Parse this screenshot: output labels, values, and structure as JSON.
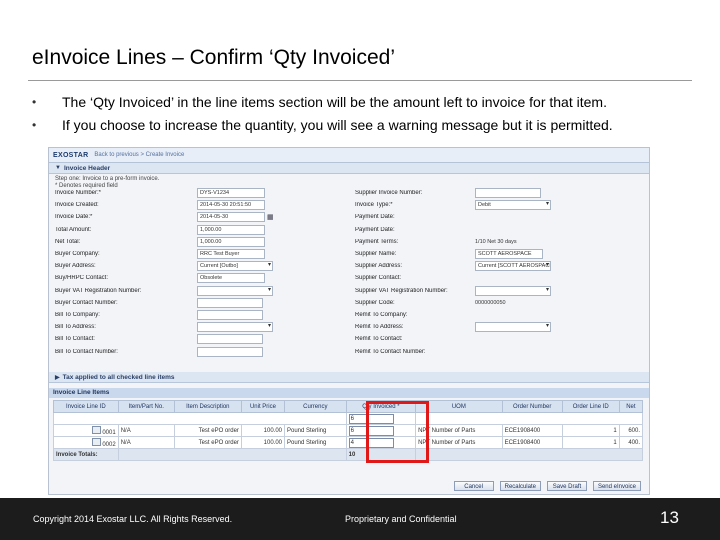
{
  "slide": {
    "title": "eInvoice Lines – Confirm ‘Qty Invoiced’",
    "bullets": [
      "The ‘Qty Invoiced’ in the line items section will be the amount left to invoice for that item.",
      "If you choose to increase the quantity, you will see a warning message but it is permitted."
    ],
    "bullet_glyph": "•"
  },
  "screenshot": {
    "logo": "EXOSTAR",
    "breadcrumb": "Back to previous > Create Invoice",
    "invoice_header_title": "Invoice Header",
    "hint_line1": "Step one: Invoice to a pre-form invoice.",
    "hint_line2": "* Denotes required field",
    "left_fields": [
      {
        "label": "Invoice Number:*",
        "value": "DYS-V1234",
        "kind": "text"
      },
      {
        "label": "Invoice Created:",
        "value": "2014-05-30 20:51:50",
        "kind": "text"
      },
      {
        "label": "Invoice Date:*",
        "value": "2014-05-30",
        "kind": "date"
      },
      {
        "label": "Total Amount:",
        "value": "1,000.00",
        "kind": "text"
      },
      {
        "label": "Net Total:",
        "value": "1,000.00",
        "kind": "text"
      },
      {
        "label": "Buyer Company:",
        "value": "RRC Test Buyer",
        "kind": "text"
      },
      {
        "label": "Buyer Address:",
        "value": "Current [Outbo]",
        "kind": "select"
      },
      {
        "label": "Buy/HRPC Contact:",
        "value": "Obsolete",
        "kind": "text"
      },
      {
        "label": "Buyer VAT Registration Number:",
        "value": "",
        "kind": "select"
      },
      {
        "label": "Buyer Contact Number:",
        "value": "",
        "kind": "box"
      },
      {
        "label": "Bill To Company:",
        "value": "",
        "kind": "box"
      },
      {
        "label": "Bill To Address:",
        "value": "",
        "kind": "select"
      },
      {
        "label": "Bill To Contact:",
        "value": "",
        "kind": "box"
      },
      {
        "label": "Bill To Contact Number:",
        "value": "",
        "kind": "box"
      }
    ],
    "right_fields": [
      {
        "label": "Supplier Invoice Number:",
        "value": "",
        "kind": "box"
      },
      {
        "label": "Invoice Type:*",
        "value": "Debit",
        "kind": "select"
      },
      {
        "label": "Payment Date:",
        "value": "",
        "kind": "none"
      },
      {
        "label": "Payment Date:",
        "value": "",
        "kind": "none"
      },
      {
        "label": "Payment Terms:",
        "value": "1/10 Net 30 days",
        "kind": "plain"
      },
      {
        "label": "Supplier Name:",
        "value": "SCOTT AEROSPACE",
        "kind": "text"
      },
      {
        "label": "Supplier Address:",
        "value": "Current [SCOTT AEROSPACE - TD]",
        "kind": "select"
      },
      {
        "label": "Supplier Contact:",
        "value": "",
        "kind": "none"
      },
      {
        "label": "Supplier VAT Registration Number:",
        "value": "",
        "kind": "select"
      },
      {
        "label": "Supplier Code:",
        "value": "0000000050",
        "kind": "plain"
      },
      {
        "label": "Remit To Company:",
        "value": "",
        "kind": "none"
      },
      {
        "label": "Remit To Address:",
        "value": "",
        "kind": "select"
      },
      {
        "label": "Remit To Contact:",
        "value": "",
        "kind": "none"
      },
      {
        "label": "Remit To Contact Number:",
        "value": "",
        "kind": "none"
      }
    ],
    "tax_section_title": "Tax applied to all checked line items",
    "lines_title": "Invoice Line Items",
    "columns": [
      "Invoice Line ID",
      "Item/Part No.",
      "Item Description",
      "Unit Price",
      "Currency",
      "Qty Invoiced *",
      "UOM",
      "Order Number",
      "Order Line ID",
      "Net"
    ],
    "rows": [
      {
        "line_id": "0001",
        "part": "N/A",
        "desc": "Test ePO order",
        "price": "100.00",
        "currency": "Pound Sterling",
        "qty": "6",
        "uom": "NPT Number of Parts",
        "order": "ECE1908400",
        "order_line": "1",
        "net": "600."
      },
      {
        "line_id": "0002",
        "part": "N/A",
        "desc": "Test ePO order",
        "price": "100.00",
        "currency": "Pound Sterling",
        "qty": "4",
        "uom": "NPT Number of Parts",
        "order": "ECE1908400",
        "order_line": "1",
        "net": "400."
      }
    ],
    "first_row_qty": "6",
    "totals_label": "Invoice Totals:",
    "totals_qty": "10",
    "buttons": [
      "Cancel",
      "Recalculate",
      "Save Draft",
      "Send eInvoice"
    ]
  },
  "footer": {
    "copyright": "Copyright 2014 Exostar LLC. All Rights Reserved.",
    "confidential": "Proprietary and Confidential",
    "page_number": "13"
  }
}
